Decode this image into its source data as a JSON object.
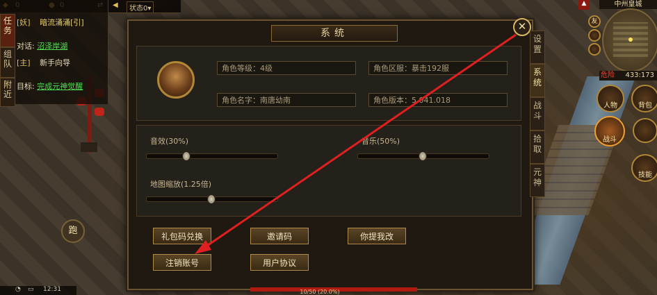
{
  "top_bar": {
    "gold_1": "0",
    "gold_2": "0",
    "status_label": "状态0▾"
  },
  "quest_panel": {
    "tabs": [
      "任务",
      "组队",
      "附近"
    ],
    "line1_tag": "[妖]",
    "line1_text": "暗流涌涌[引]",
    "line2_prefix": "对话:",
    "line2_link": "沼泽岸湖",
    "line3_tag": "[主]",
    "line3_text": "新手向导",
    "line4_prefix": "目标:",
    "line4_link": "完成元神觉醒"
  },
  "dialog": {
    "title": "系统",
    "close_label": "✕",
    "info": {
      "level": "角色等级：4级",
      "server": "角色区服：暴击192服",
      "name": "角色名字：南唐幼南",
      "version": "角色版本：5.041.018"
    },
    "sliders": [
      {
        "label": "音效(30%)",
        "value": 0.3
      },
      {
        "label": "音乐(50%)",
        "value": 0.5
      },
      {
        "label": "地图缩放(1.25倍)",
        "value": 0.5
      }
    ],
    "buttons": {
      "gift_code": "礼包码兑换",
      "invite_code": "邀请码",
      "feedback": "你提我改",
      "cancel_account": "注销账号",
      "user_agreement": "用户协议"
    }
  },
  "side_tabs": [
    "设置",
    "系统",
    "战斗",
    "拾取",
    "元神"
  ],
  "active_side_tab": "系统",
  "minimap": {
    "title": "中州皇城",
    "danger": "危险",
    "coords": "433:173"
  },
  "round_buttons": {
    "friend": "友",
    "character": "人物",
    "bag": "背包",
    "battle": "战斗",
    "skill": "技能",
    "run": "跑"
  },
  "bottom": {
    "exp_text": "10/50 (20.0%)",
    "time": "12:31"
  },
  "colors": {
    "arrow": "#e02020",
    "link": "#4ee04e",
    "gold_border": "#b08c4c"
  }
}
